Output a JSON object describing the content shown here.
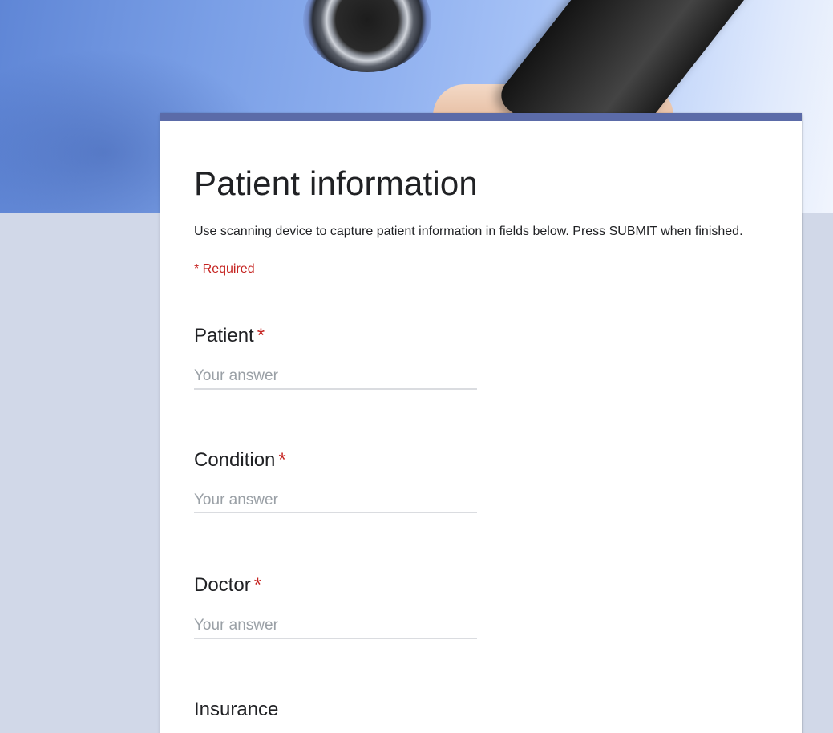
{
  "form": {
    "title": "Patient information",
    "description": "Use scanning device to capture patient information in fields below. Press SUBMIT when finished.",
    "required_note": "* Required",
    "accent_color": "#5b6ba8",
    "required_color": "#c5221f",
    "questions": [
      {
        "label": "Patient",
        "required_mark": "*",
        "placeholder": "Your answer"
      },
      {
        "label": "Condition",
        "required_mark": "*",
        "placeholder": "Your answer"
      },
      {
        "label": "Doctor",
        "required_mark": "*",
        "placeholder": "Your answer"
      },
      {
        "label": "Insurance"
      }
    ]
  }
}
